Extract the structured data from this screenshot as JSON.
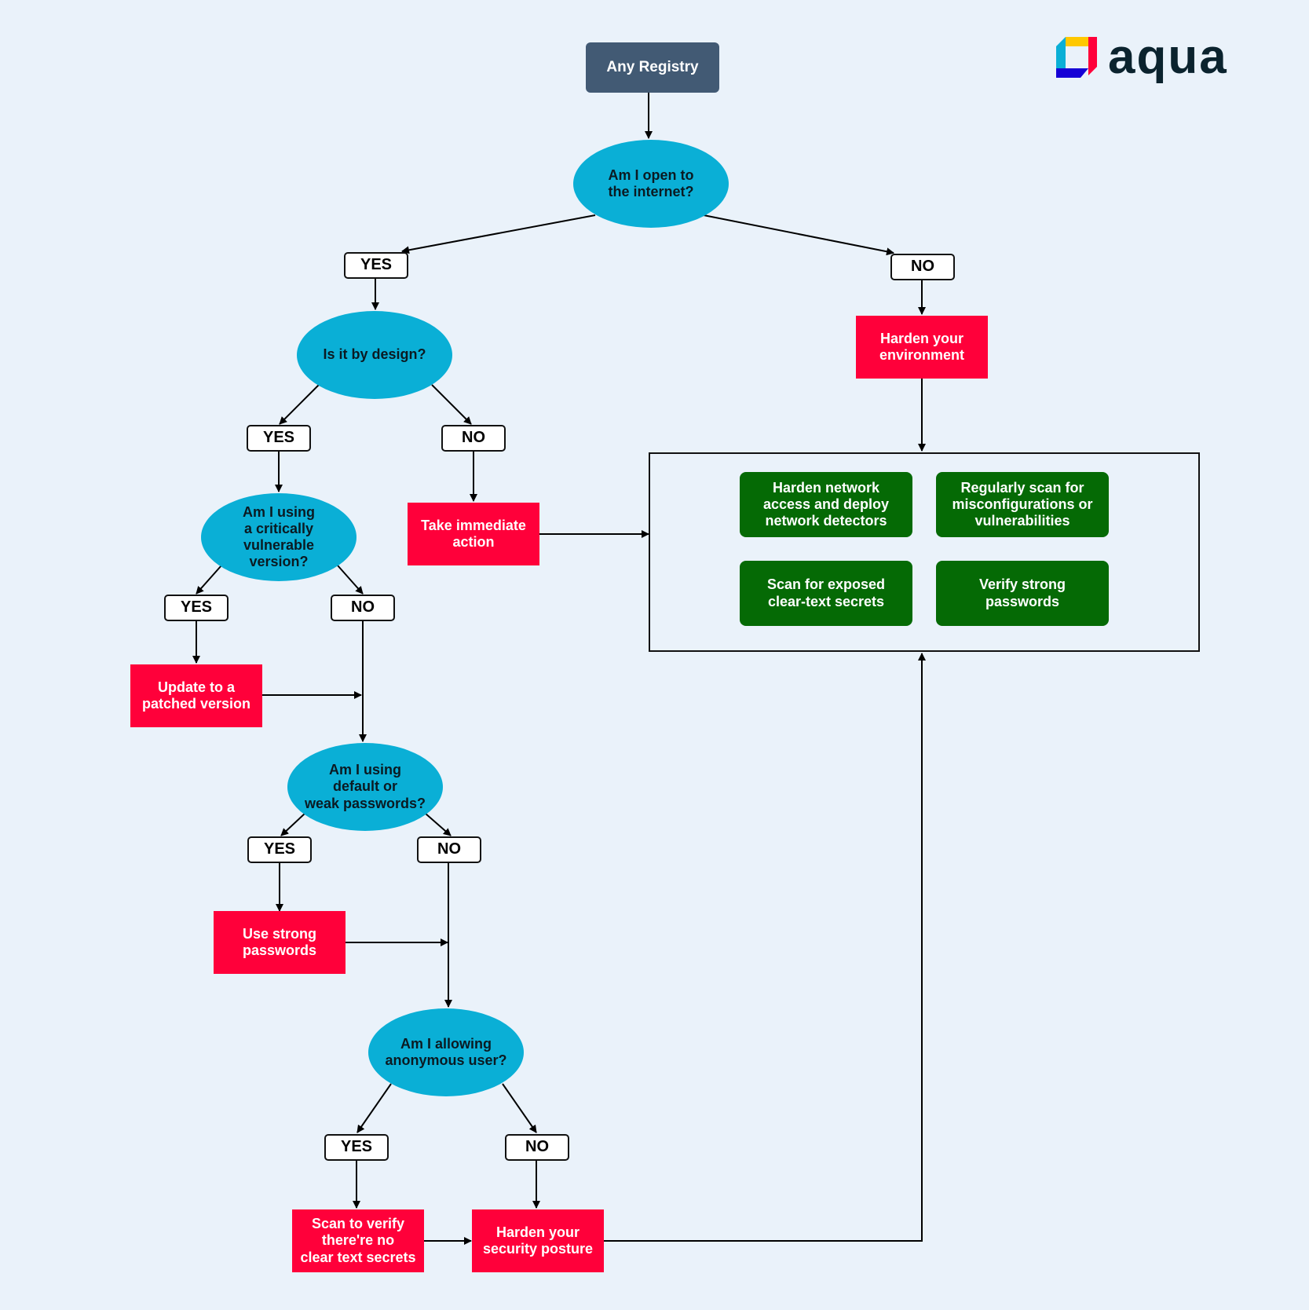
{
  "brand": {
    "name": "aqua",
    "colors": {
      "yellow": "#ffc800",
      "red": "#ff003a",
      "cyan": "#0aafd6",
      "blue": "#1500d6",
      "text": "#0b232e"
    }
  },
  "colors": {
    "start": "#425a74",
    "question": "#0aafd6",
    "action": "#ff003a",
    "recommendation": "#056a05",
    "background": "#eaf2fa"
  },
  "flow": {
    "start": "Any Registry",
    "q_internet": "Am I open to\nthe internet?",
    "q_internet_yes": "YES",
    "q_internet_no": "NO",
    "harden_env": "Harden your\nenvironment",
    "q_design": "Is it by design?",
    "q_design_yes": "YES",
    "q_design_no": "NO",
    "take_action": "Take immediate\naction",
    "q_version": "Am I using\na critically\nvulnerable\nversion?",
    "q_version_yes": "YES",
    "q_version_no": "NO",
    "update_version": "Update to a\npatched version",
    "q_passwords": "Am I using\ndefault or\nweak passwords?",
    "q_passwords_yes": "YES",
    "q_passwords_no": "NO",
    "strong_passwords": "Use strong\npasswords",
    "q_anonymous": "Am I allowing\nanonymous user?",
    "q_anonymous_yes": "YES",
    "q_anonymous_no": "NO",
    "scan_secrets": "Scan to verify\nthere're no\nclear text secrets",
    "harden_posture": "Harden your\nsecurity posture"
  },
  "recommendations": [
    "Harden network\naccess and deploy\nnetwork detectors",
    "Regularly scan for\nmisconfigurations or\nvulnerabilities",
    "Scan for exposed\nclear-text secrets",
    "Verify strong\npasswords"
  ]
}
